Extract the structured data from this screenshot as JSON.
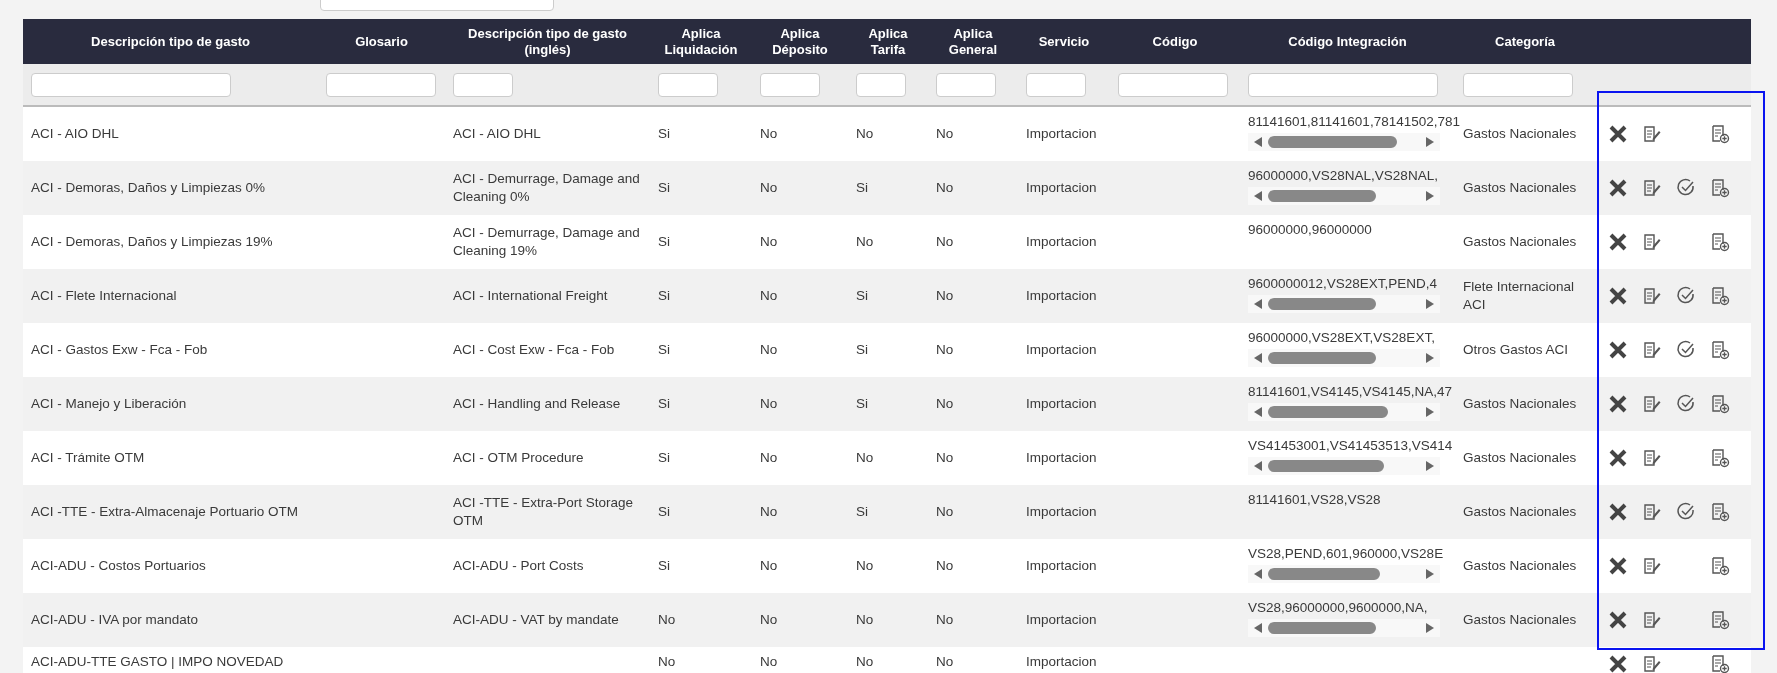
{
  "highlight_actions": true,
  "table": {
    "columns": [
      "Descripción tipo de gasto",
      "Glosario",
      "Descripción tipo de gasto (inglés)",
      "Aplica Liquidación",
      "Aplica Déposito",
      "Aplica Tarifa",
      "Aplica General",
      "Servicio",
      "Código",
      "Código Integración",
      "Categoría"
    ],
    "rows": [
      {
        "descripcion": "ACI - AIO DHL",
        "ingles": "ACI - AIO DHL",
        "liquidacion": "Si",
        "deposito": "No",
        "tarifa": "No",
        "general": "No",
        "servicio": "Importacion",
        "integracion": "81141601,81141601,78141502,781",
        "scrollable": true,
        "categoria": "Gastos Nacionales",
        "validate_action": false
      },
      {
        "descripcion": "ACI - Demoras, Daños y Limpiezas 0%",
        "ingles": "ACI - Demurrage, Damage and Cleaning 0%",
        "liquidacion": "Si",
        "deposito": "No",
        "tarifa": "Si",
        "general": "No",
        "servicio": "Importacion",
        "integracion": "96000000,VS28NAL,VS28NAL,",
        "scrollable": true,
        "categoria": "Gastos Nacionales",
        "validate_action": true
      },
      {
        "descripcion": "ACI - Demoras, Daños y Limpiezas 19%",
        "ingles": "ACI - Demurrage, Damage and Cleaning 19%",
        "liquidacion": "Si",
        "deposito": "No",
        "tarifa": "No",
        "general": "No",
        "servicio": "Importacion",
        "integracion": "96000000,96000000",
        "scrollable": false,
        "categoria": "Gastos Nacionales",
        "validate_action": false
      },
      {
        "descripcion": "ACI - Flete Internacional",
        "ingles": "ACI - International Freight",
        "liquidacion": "Si",
        "deposito": "No",
        "tarifa": "Si",
        "general": "No",
        "servicio": "Importacion",
        "integracion": "9600000012,VS28EXT,PEND,4",
        "scrollable": true,
        "categoria": "Flete Internacional ACI",
        "validate_action": true
      },
      {
        "descripcion": "ACI - Gastos Exw - Fca - Fob",
        "ingles": "ACI - Cost Exw - Fca - Fob",
        "liquidacion": "Si",
        "deposito": "No",
        "tarifa": "Si",
        "general": "No",
        "servicio": "Importacion",
        "integracion": "96000000,VS28EXT,VS28EXT,",
        "scrollable": true,
        "categoria": "Otros Gastos ACI",
        "validate_action": true
      },
      {
        "descripcion": "ACI - Manejo y Liberación",
        "ingles": "ACI - Handling and Release",
        "liquidacion": "Si",
        "deposito": "No",
        "tarifa": "Si",
        "general": "No",
        "servicio": "Importacion",
        "integracion": "81141601,VS4145,VS4145,NA,47",
        "scrollable": true,
        "categoria": "Gastos Nacionales",
        "validate_action": true
      },
      {
        "descripcion": "ACI - Trámite OTM",
        "ingles": "ACI - OTM Procedure",
        "liquidacion": "Si",
        "deposito": "No",
        "tarifa": "No",
        "general": "No",
        "servicio": "Importacion",
        "integracion": "VS41453001,VS41453513,VS414",
        "scrollable": true,
        "categoria": "Gastos Nacionales",
        "validate_action": false
      },
      {
        "descripcion": "ACI -TTE - Extra-Almacenaje Portuario OTM",
        "ingles": "ACI -TTE - Extra-Port Storage OTM",
        "liquidacion": "Si",
        "deposito": "No",
        "tarifa": "Si",
        "general": "No",
        "servicio": "Importacion",
        "integracion": "81141601,VS28,VS28",
        "scrollable": false,
        "categoria": "Gastos Nacionales",
        "validate_action": true
      },
      {
        "descripcion": "ACI-ADU - Costos Portuarios",
        "ingles": "ACI-ADU - Port Costs",
        "liquidacion": "Si",
        "deposito": "No",
        "tarifa": "No",
        "general": "No",
        "servicio": "Importacion",
        "integracion": "VS28,PEND,601,960000,VS28E",
        "scrollable": true,
        "categoria": "Gastos Nacionales",
        "validate_action": false
      },
      {
        "descripcion": "ACI-ADU - IVA por mandato",
        "ingles": "ACI-ADU - VAT by mandate",
        "liquidacion": "No",
        "deposito": "No",
        "tarifa": "No",
        "general": "No",
        "servicio": "Importacion",
        "integracion": "VS28,96000000,9600000,NA,",
        "scrollable": true,
        "categoria": "Gastos Nacionales",
        "validate_action": false
      },
      {
        "descripcion": "ACI-ADU-TTE GASTO | IMPO NOVEDAD",
        "liquidacion": "No",
        "deposito": "No",
        "tarifa": "No",
        "general": "No",
        "servicio": "Importacion",
        "scrollable": false,
        "validate_action": false
      }
    ]
  }
}
